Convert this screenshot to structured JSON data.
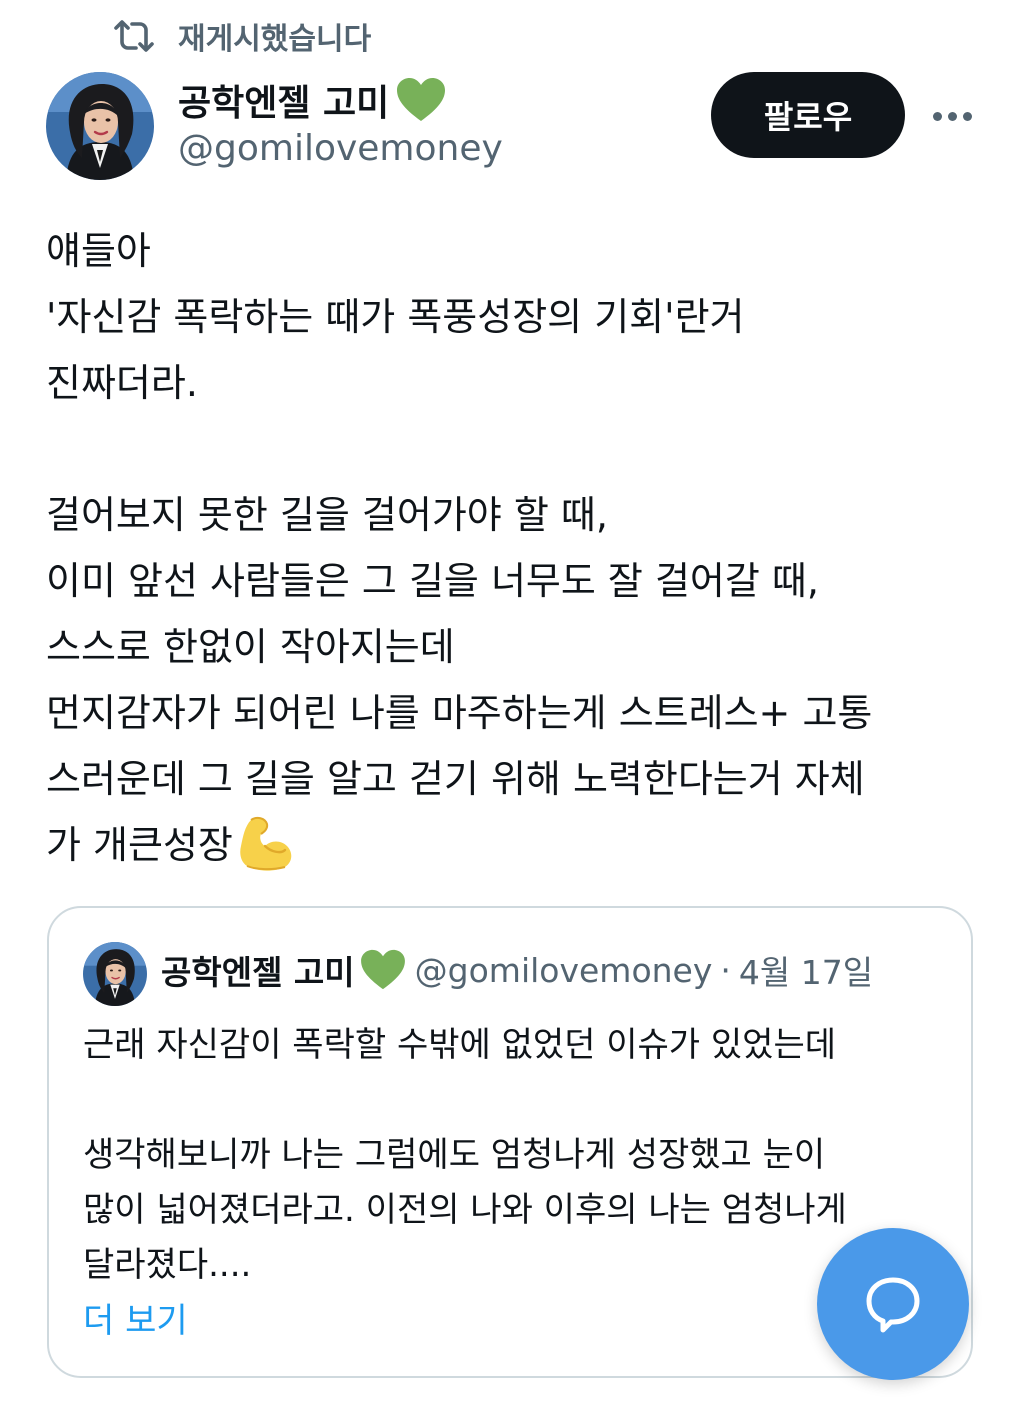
{
  "repost": {
    "icon": "repost-icon",
    "label": "재게시했습니다"
  },
  "author": {
    "name": "공학엔젤 고미",
    "emoji": "green-heart-icon",
    "handle": "@gomilovemoney",
    "follow_label": "팔로우",
    "more_icon": "more-options-icon"
  },
  "tweet": {
    "lines": [
      "얘들아",
      "'자신감 폭락하는 때가 폭풍성장의 기회'란거",
      "진짜더라.",
      "",
      "걸어보지 못한 길을 걸어가야 할 때,",
      "이미 앞선 사람들은 그 길을 너무도 잘 걸어갈 때,",
      "스스로 한없이 작아지는데",
      "먼지감자가 되어린 나를 마주하는게 스트레스+ 고통",
      "스러운데 그 길을 알고 걷기 위해 노력한다는거 자체",
      "가 개큰성장"
    ],
    "trailing_emoji": "flexed-biceps-icon"
  },
  "quote": {
    "name": "공학엔젤 고미",
    "emoji": "green-heart-icon",
    "handle": "@gomilovemoney",
    "separator": "·",
    "date": "4월 17일",
    "lines": [
      "근래 자신감이 폭락할 수밖에 없었던 이슈가 있었는데",
      "",
      "생각해보니까 나는 그럼에도 엄청나게 성장했고 눈이",
      "많이 넓어졌더라고. 이전의 나와 이후의 나는 엄청나게",
      "달라졌다...."
    ],
    "more_label": "더 보기"
  },
  "fab": {
    "icon": "chat-bubble-icon"
  },
  "colors": {
    "text": "#0f1419",
    "secondary": "#536471",
    "link": "#1d9bf0",
    "follow_bg": "#0f1419",
    "fab_bg": "#4a99e9",
    "border": "#cfd9de",
    "heart": "#78b159"
  }
}
